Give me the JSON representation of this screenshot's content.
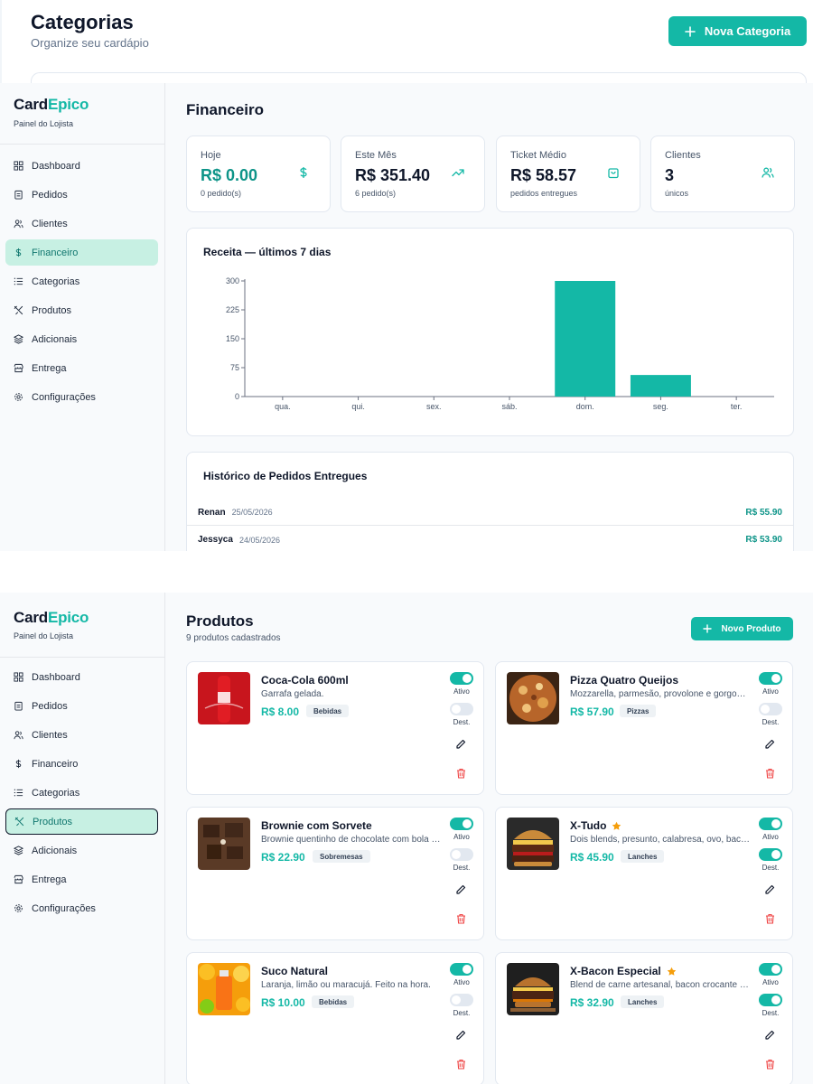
{
  "categorias": {
    "title": "Categorias",
    "subtitle": "Organize seu cardápio",
    "new_button": "Nova Categoria"
  },
  "brand": {
    "name_part1": "Card",
    "name_part2": "Epico",
    "subtitle": "Painel do Lojista",
    "accent_color": "#14b8a6"
  },
  "nav": {
    "items": [
      {
        "label": "Dashboard",
        "icon": "grid-icon"
      },
      {
        "label": "Pedidos",
        "icon": "clipboard-icon"
      },
      {
        "label": "Clientes",
        "icon": "users-icon"
      },
      {
        "label": "Financeiro",
        "icon": "dollar-icon"
      },
      {
        "label": "Categorias",
        "icon": "list-icon"
      },
      {
        "label": "Produtos",
        "icon": "utensils-icon"
      },
      {
        "label": "Adicionais",
        "icon": "layers-icon"
      },
      {
        "label": "Entrega",
        "icon": "store-icon"
      },
      {
        "label": "Configurações",
        "icon": "gear-icon"
      }
    ]
  },
  "financeiro": {
    "title": "Financeiro",
    "stats": [
      {
        "label": "Hoje",
        "value": "R$ 0.00",
        "note": "0 pedido(s)",
        "icon": "dollar-icon"
      },
      {
        "label": "Este Mês",
        "value": "R$ 351.40",
        "note": "6 pedido(s)",
        "icon": "trending-up-icon"
      },
      {
        "label": "Ticket Médio",
        "value": "R$ 58.57",
        "note": "pedidos entregues",
        "icon": "shopping-bag-icon"
      },
      {
        "label": "Clientes",
        "value": "3",
        "note": "únicos",
        "icon": "users-icon"
      }
    ],
    "history": {
      "title": "Histórico de Pedidos Entregues",
      "rows": [
        {
          "name": "Renan",
          "date": "25/05/2026",
          "amount": "R$ 55.90"
        },
        {
          "name": "Jessyca",
          "date": "24/05/2026",
          "amount": "R$ 53.90"
        }
      ]
    }
  },
  "chart_data": {
    "type": "bar",
    "title": "Receita — últimos 7 dias",
    "categories": [
      "qua.",
      "qui.",
      "sex.",
      "sáb.",
      "dom.",
      "seg.",
      "ter."
    ],
    "values": [
      0,
      0,
      0,
      0,
      300,
      56,
      0
    ],
    "yticks": [
      0,
      75,
      150,
      225,
      300
    ],
    "ylim": [
      0,
      300
    ],
    "xlabel": "",
    "ylabel": "",
    "grid": false,
    "bar_color": "#14b8a6"
  },
  "produtos": {
    "title": "Produtos",
    "subtitle": "9 produtos cadastrados",
    "new_button": "Novo Produto",
    "toggle_active_label": "Ativo",
    "toggle_featured_label": "Dest.",
    "items": [
      {
        "name": "Coca-Cola 600ml",
        "desc": "Garrafa gelada.",
        "price": "R$ 8.00",
        "category": "Bebidas",
        "featured_star": false,
        "active": true,
        "featured": false
      },
      {
        "name": "Pizza Quatro Queijos",
        "desc": "Mozzarella, parmesão, provolone e gorgonzola.",
        "price": "R$ 57.90",
        "category": "Pizzas",
        "featured_star": false,
        "active": true,
        "featured": false
      },
      {
        "name": "Brownie com Sorvete",
        "desc": "Brownie quentinho de chocolate com bola de sorvete.",
        "price": "R$ 22.90",
        "category": "Sobremesas",
        "featured_star": false,
        "active": true,
        "featured": false
      },
      {
        "name": "X-Tudo",
        "desc": "Dois blends, presunto, calabresa, ovo, bacon e queijo.",
        "price": "R$ 45.90",
        "category": "Lanches",
        "featured_star": true,
        "active": true,
        "featured": true
      },
      {
        "name": "Suco Natural",
        "desc": "Laranja, limão ou maracujá. Feito na hora.",
        "price": "R$ 10.00",
        "category": "Bebidas",
        "featured_star": false,
        "active": true,
        "featured": false
      },
      {
        "name": "X-Bacon Especial",
        "desc": "Blend de carne artesanal, bacon crocante e cheddar.",
        "price": "R$ 32.90",
        "category": "Lanches",
        "featured_star": true,
        "active": true,
        "featured": true
      }
    ]
  }
}
